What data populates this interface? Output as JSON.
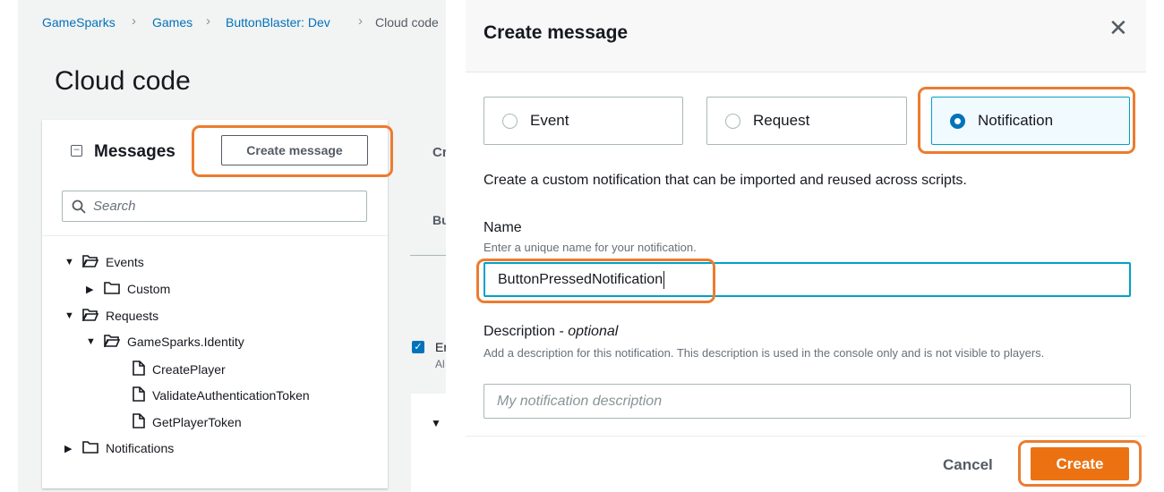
{
  "breadcrumb": [
    "GameSparks",
    "Games",
    "ButtonBlaster: Dev",
    "Cloud code"
  ],
  "page_title": "Cloud code",
  "messages_panel": {
    "title": "Messages",
    "create_button": "Create message",
    "search_placeholder": "Search",
    "tree": [
      {
        "label": "Events",
        "level": 0,
        "type": "folder-open",
        "expanded": true
      },
      {
        "label": "Custom",
        "level": 1,
        "type": "folder",
        "expanded": false
      },
      {
        "label": "Requests",
        "level": 0,
        "type": "folder-open",
        "expanded": true
      },
      {
        "label": "GameSparks.Identity",
        "level": 1,
        "type": "folder-open",
        "expanded": true
      },
      {
        "label": "CreatePlayer",
        "level": 2,
        "type": "file"
      },
      {
        "label": "ValidateAuthenticationToken",
        "level": 2,
        "type": "file"
      },
      {
        "label": "GetPlayerToken",
        "level": 2,
        "type": "file"
      },
      {
        "label": "Notifications",
        "level": 0,
        "type": "folder",
        "expanded": false
      }
    ]
  },
  "partial": {
    "a": "Cr",
    "b": "Bu",
    "c": "Er",
    "d": "Al"
  },
  "modal": {
    "title": "Create message",
    "types": [
      {
        "label": "Event",
        "selected": false
      },
      {
        "label": "Request",
        "selected": false
      },
      {
        "label": "Notification",
        "selected": true
      }
    ],
    "type_description": "Create a custom notification that can be imported and reused across scripts.",
    "name_label": "Name",
    "name_hint": "Enter a unique name for your notification.",
    "name_value": "ButtonPressedNotification",
    "desc_label": "Description - ",
    "desc_optional": "optional",
    "desc_hint": "Add a description for this notification. This description is used in the console only and is not visible to players.",
    "desc_placeholder": "My notification description",
    "cancel": "Cancel",
    "create": "Create"
  },
  "colors": {
    "accent": "#ec7211",
    "link": "#0073bb",
    "highlight": "#ec7c30"
  }
}
